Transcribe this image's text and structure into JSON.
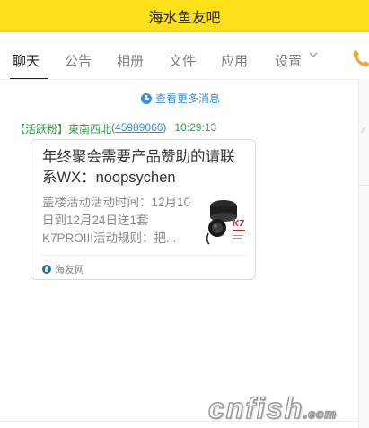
{
  "window": {
    "title": "海水鱼友吧"
  },
  "tabs": [
    {
      "label": "聊天",
      "active": true
    },
    {
      "label": "公告"
    },
    {
      "label": "相册"
    },
    {
      "label": "文件"
    },
    {
      "label": "应用"
    },
    {
      "label": "设置"
    }
  ],
  "icons": {
    "more": "clock-icon",
    "settings_dropdown": "chevron-down-icon",
    "call": "phone-icon",
    "source": "haiyou-logo-icon"
  },
  "chat": {
    "more_messages": "查看更多消息",
    "message": {
      "sender_tag": "【活跃粉】",
      "sender_name": "東南西北",
      "sender_id_open": "(",
      "sender_id": "45989066",
      "sender_id_close": ")",
      "time": "10:29:13",
      "card": {
        "title": "年终聚会需要产品赞助的请联系WX：noopsychen",
        "description": "盖楼活动活动时间：12月10日到12月24日送1套K7PROIII活动规则：把...",
        "source": "海友网"
      }
    }
  },
  "watermark": {
    "text": "cnfish",
    "tld": ".com"
  },
  "colors": {
    "titlebar_bg": "#ffe01b",
    "link_blue": "#3a8fe0",
    "sender_green": "#2e9a4a",
    "phone_orange": "#f5a623"
  }
}
